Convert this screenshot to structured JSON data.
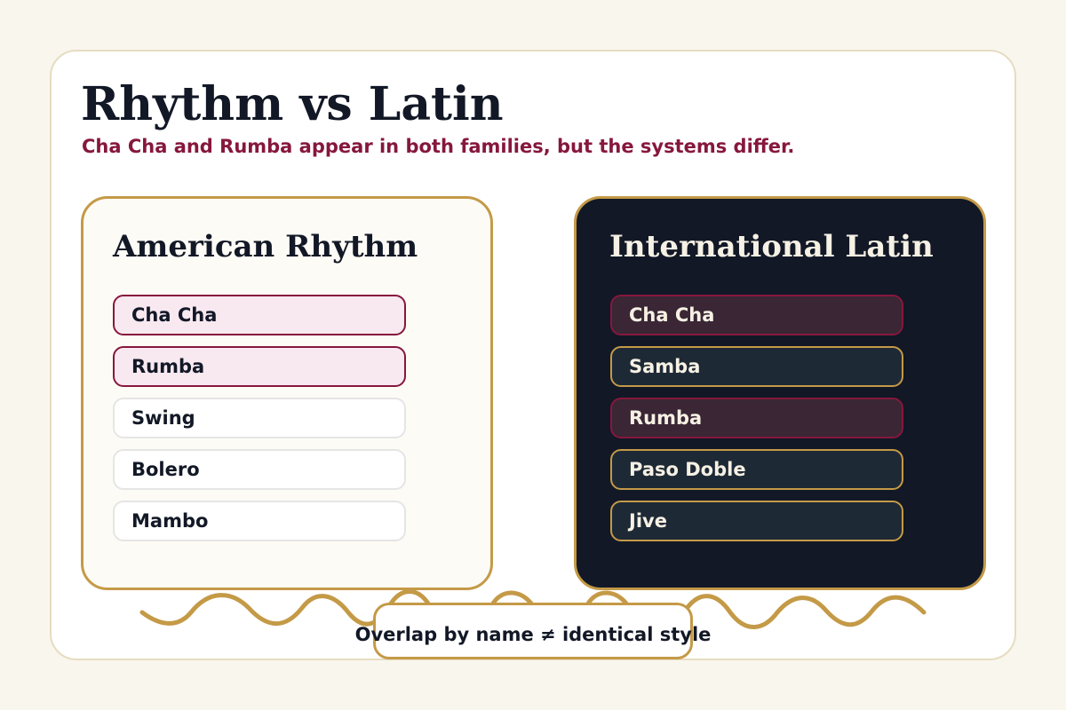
{
  "title": "Rhythm vs Latin",
  "subtitle": "Cha Cha and Rumba appear in both families, but the systems differ.",
  "colors": {
    "background": "#f9f6ee",
    "ink": "#121826",
    "accent_gold": "#c49a47",
    "accent_burgundy": "#86173d",
    "dark_panel": "#121826"
  },
  "american_rhythm": {
    "title": "American Rhythm",
    "items": [
      {
        "label": "Cha Cha",
        "shared": true
      },
      {
        "label": "Rumba",
        "shared": true
      },
      {
        "label": "Swing",
        "shared": false
      },
      {
        "label": "Bolero",
        "shared": false
      },
      {
        "label": "Mambo",
        "shared": false
      }
    ]
  },
  "international_latin": {
    "title": "International Latin",
    "items": [
      {
        "label": "Cha Cha",
        "shared": true
      },
      {
        "label": "Samba",
        "shared": false
      },
      {
        "label": "Rumba",
        "shared": true
      },
      {
        "label": "Paso Doble",
        "shared": false
      },
      {
        "label": "Jive",
        "shared": false
      }
    ]
  },
  "callout": "Overlap by name ≠ identical style"
}
